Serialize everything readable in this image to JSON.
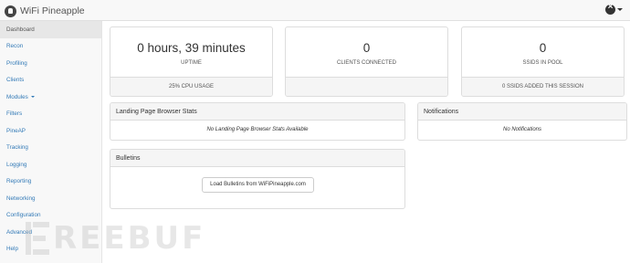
{
  "app": {
    "title": "WiFi Pineapple"
  },
  "sidebar": {
    "items": [
      {
        "label": "Dashboard"
      },
      {
        "label": "Recon"
      },
      {
        "label": "Profiling"
      },
      {
        "label": "Clients"
      },
      {
        "label": "Modules"
      },
      {
        "label": "Filters"
      },
      {
        "label": "PineAP"
      },
      {
        "label": "Tracking"
      },
      {
        "label": "Logging"
      },
      {
        "label": "Reporting"
      },
      {
        "label": "Networking"
      },
      {
        "label": "Configuration"
      },
      {
        "label": "Advanced"
      },
      {
        "label": "Help"
      }
    ]
  },
  "stats": [
    {
      "value": "0 hours, 39 minutes",
      "label": "UPTIME",
      "footer": "25% CPU USAGE"
    },
    {
      "value": "0",
      "label": "CLIENTS CONNECTED",
      "footer": ""
    },
    {
      "value": "0",
      "label": "SSIDS IN POOL",
      "footer": "0 SSIDS ADDED THIS SESSION"
    }
  ],
  "landing": {
    "title": "Landing Page Browser Stats",
    "empty": "No Landing Page Browser Stats Available"
  },
  "notifications": {
    "title": "Notifications",
    "empty": "No Notifications"
  },
  "bulletins": {
    "title": "Bulletins",
    "button": "Load Bulletins from WiFiPineapple.com"
  },
  "watermark": {
    "text": "REEBUF"
  }
}
